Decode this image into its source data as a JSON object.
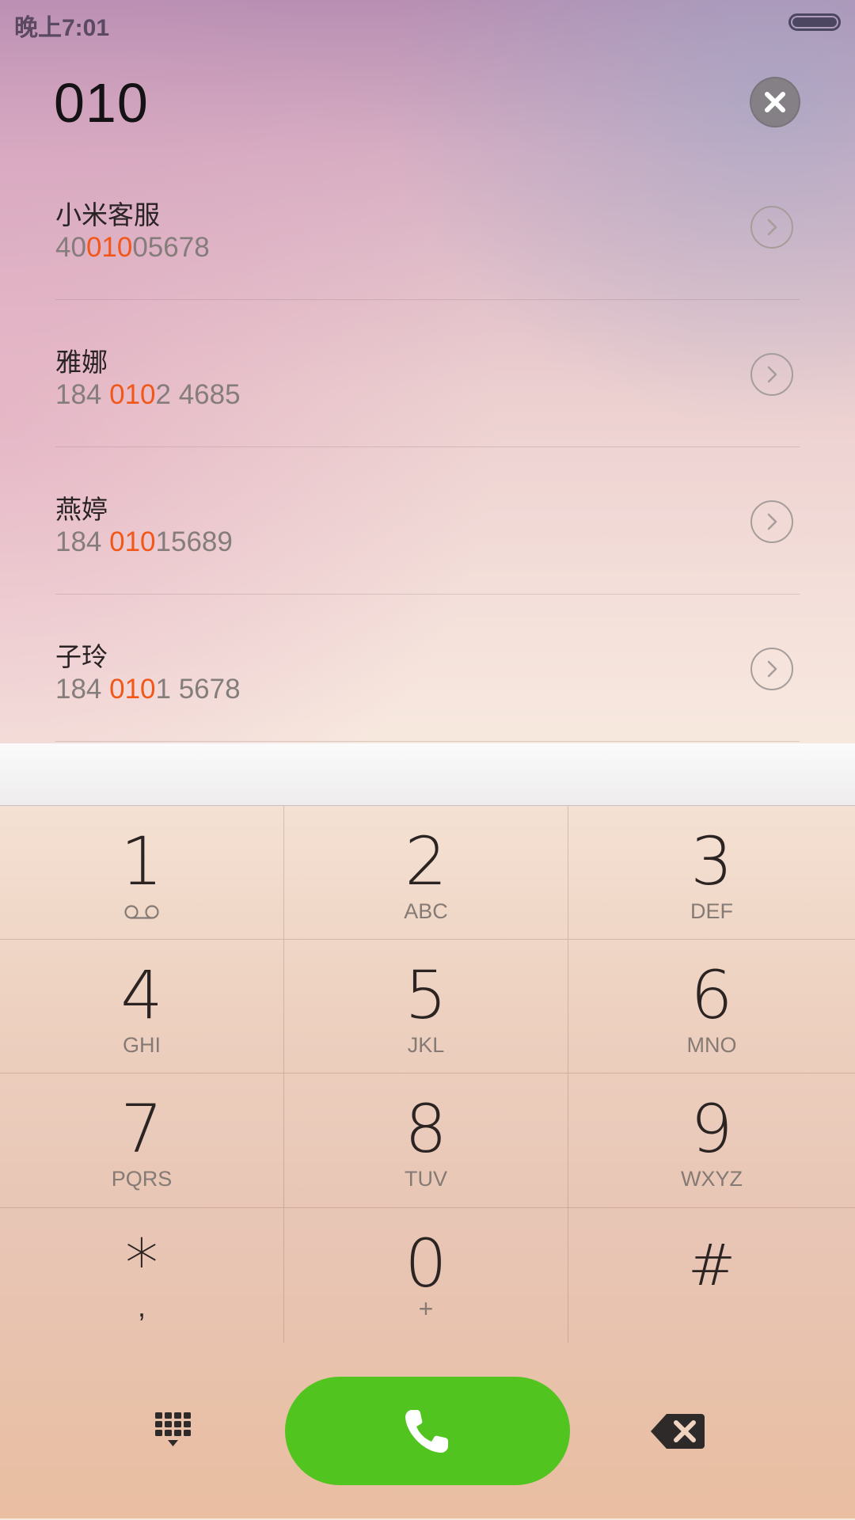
{
  "status_bar": {
    "time": "晚上7:01",
    "battery_icon": "battery-icon"
  },
  "dialer": {
    "dialed_number": "010",
    "clear_icon": "close-icon"
  },
  "contacts": [
    {
      "name": "小米客服",
      "number_parts": [
        "40",
        "010",
        "05678"
      ]
    },
    {
      "name": "雅娜",
      "number_parts": [
        "184 ",
        "010",
        "2 4685"
      ]
    },
    {
      "name": "燕婷",
      "number_parts": [
        "184 ",
        "010",
        "15689"
      ]
    },
    {
      "name": "子玲",
      "number_parts": [
        "184 ",
        "010",
        "1 5678"
      ]
    }
  ],
  "keypad": {
    "keys": [
      {
        "digit": "1",
        "letters": "",
        "icon": "voicemail-icon"
      },
      {
        "digit": "2",
        "letters": "ABC"
      },
      {
        "digit": "3",
        "letters": "DEF"
      },
      {
        "digit": "4",
        "letters": "GHI"
      },
      {
        "digit": "5",
        "letters": "JKL"
      },
      {
        "digit": "6",
        "letters": "MNO"
      },
      {
        "digit": "7",
        "letters": "PQRS"
      },
      {
        "digit": "8",
        "letters": "TUV"
      },
      {
        "digit": "9",
        "letters": "WXYZ"
      },
      {
        "digit": "*",
        "letters": ","
      },
      {
        "digit": "0",
        "letters": "+"
      },
      {
        "digit": "#",
        "letters": ""
      }
    ]
  },
  "actions": {
    "dialpad_icon": "dialpad-icon",
    "call_icon": "phone-icon",
    "backspace_icon": "backspace-icon"
  },
  "colors": {
    "highlight": "#f2571a",
    "call_button": "#52c41f",
    "text_primary": "#2a2326",
    "text_secondary": "#857c7c"
  }
}
